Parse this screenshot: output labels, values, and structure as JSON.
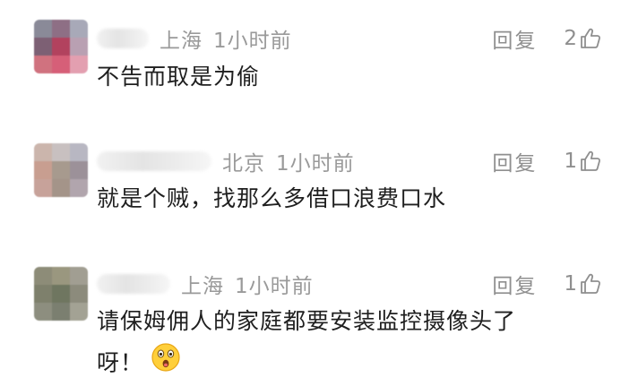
{
  "comments": [
    {
      "location": "上海",
      "time": "1小时前",
      "reply_label": "回复",
      "likes": "2",
      "text": "不告而取是为偷"
    },
    {
      "location": "北京",
      "time": "1小时前",
      "reply_label": "回复",
      "likes": "1",
      "text": "就是个贼，找那么多借口浪费口水"
    },
    {
      "location": "上海",
      "time": "1小时前",
      "reply_label": "回复",
      "likes": "1",
      "text": "请保姆佣人的家庭都要安装监控摄像头了呀！",
      "emoji": "surprised-face-emoji"
    }
  ],
  "colors": {
    "meta_text": "#9a9a9a",
    "content_text": "#1f1f1f",
    "background": "#ffffff"
  },
  "icons": {
    "like": "thumbs-up-icon"
  }
}
